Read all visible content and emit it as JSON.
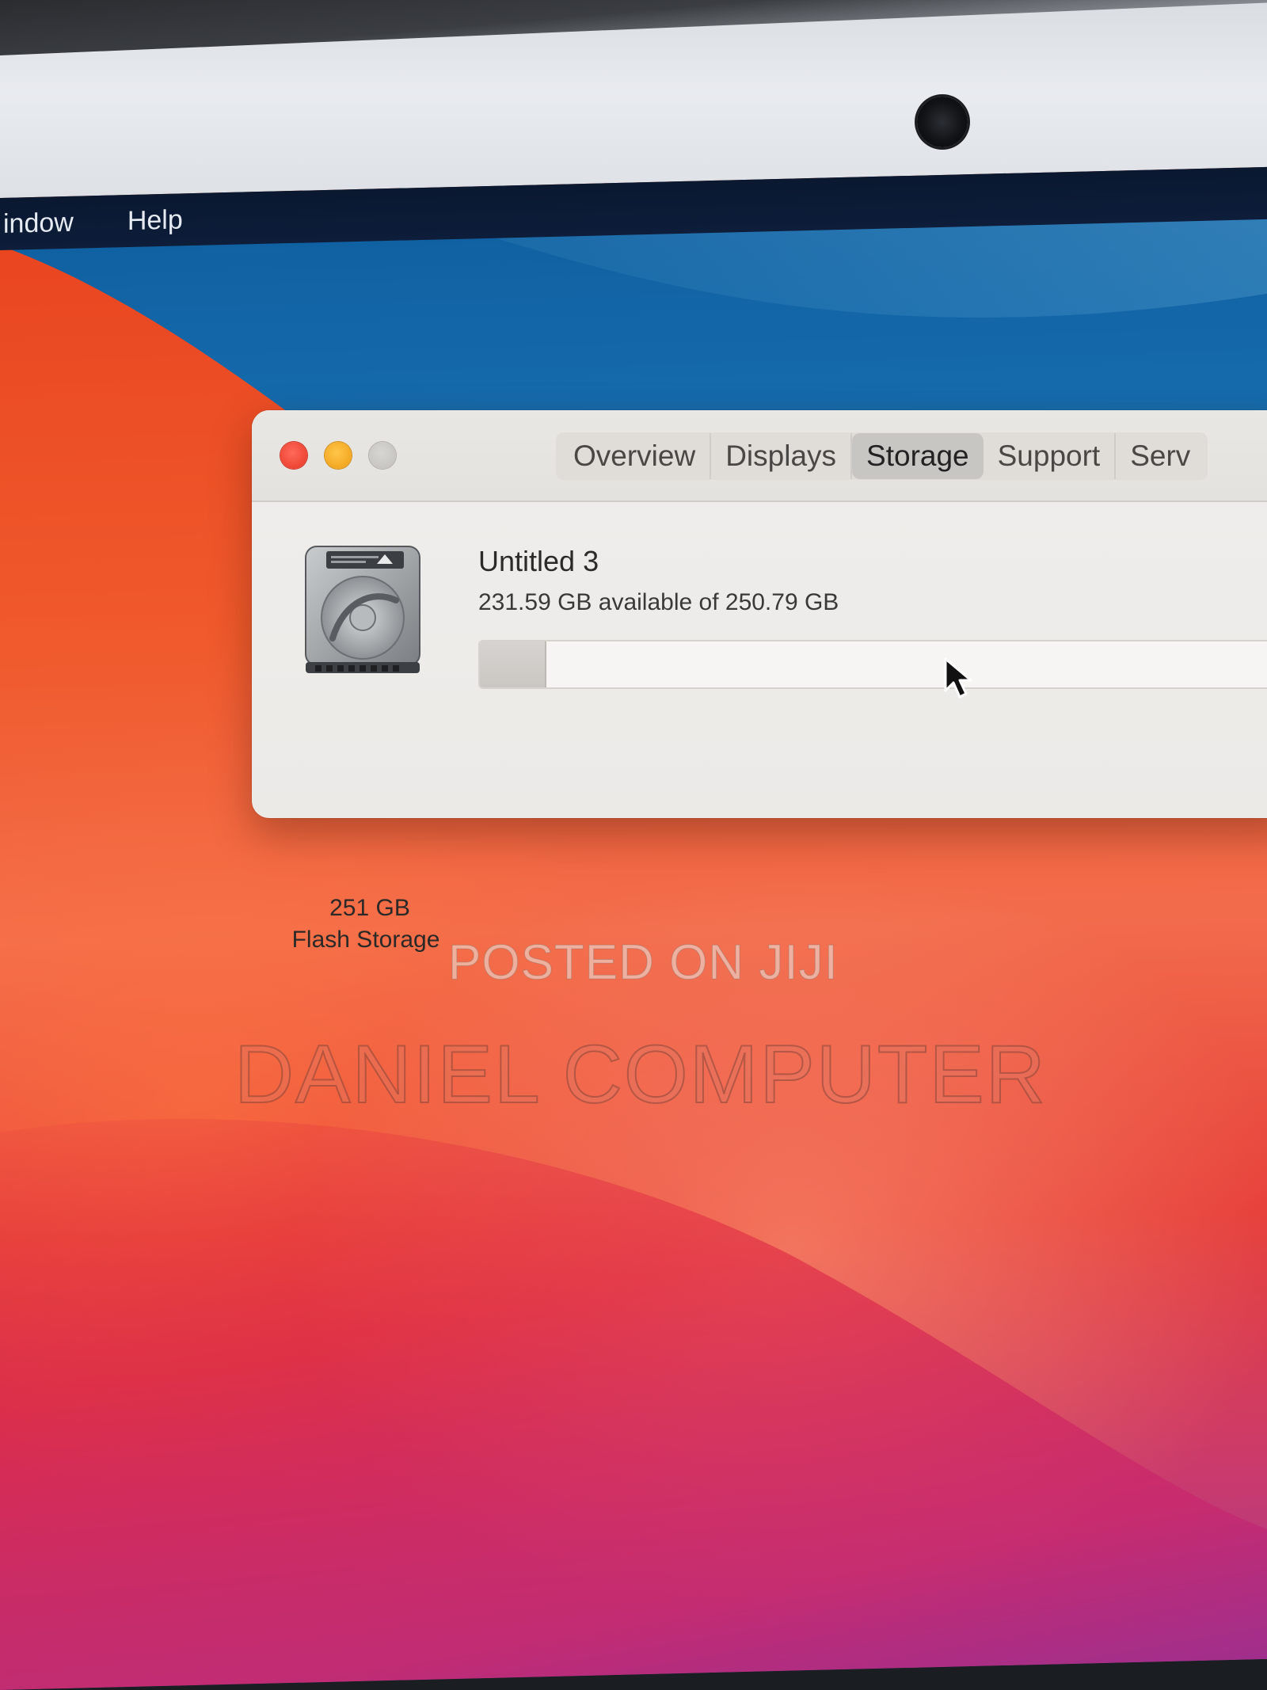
{
  "menubar": {
    "items": [
      "indow",
      "Help"
    ]
  },
  "about_window": {
    "tabs": [
      "Overview",
      "Displays",
      "Storage",
      "Support",
      "Serv"
    ],
    "active_tab": "Storage",
    "drive": {
      "size": "251 GB",
      "type": "Flash Storage",
      "icon": "hard-drive-icon"
    },
    "volume": {
      "name": "Untitled 3",
      "availability": "231.59 GB available of 250.79 GB",
      "used_fraction": 0.077
    }
  },
  "watermarks": [
    "POSTED ON JIJI",
    "DANIEL COMPUTER"
  ],
  "colors": {
    "close": "#ee4534",
    "minimize": "#f3a823",
    "zoom": "#c8c6c2",
    "menubar": "#0d1d3a",
    "wallpaper_blue": "#1b78bb",
    "wallpaper_orange": "#f05a2c"
  }
}
